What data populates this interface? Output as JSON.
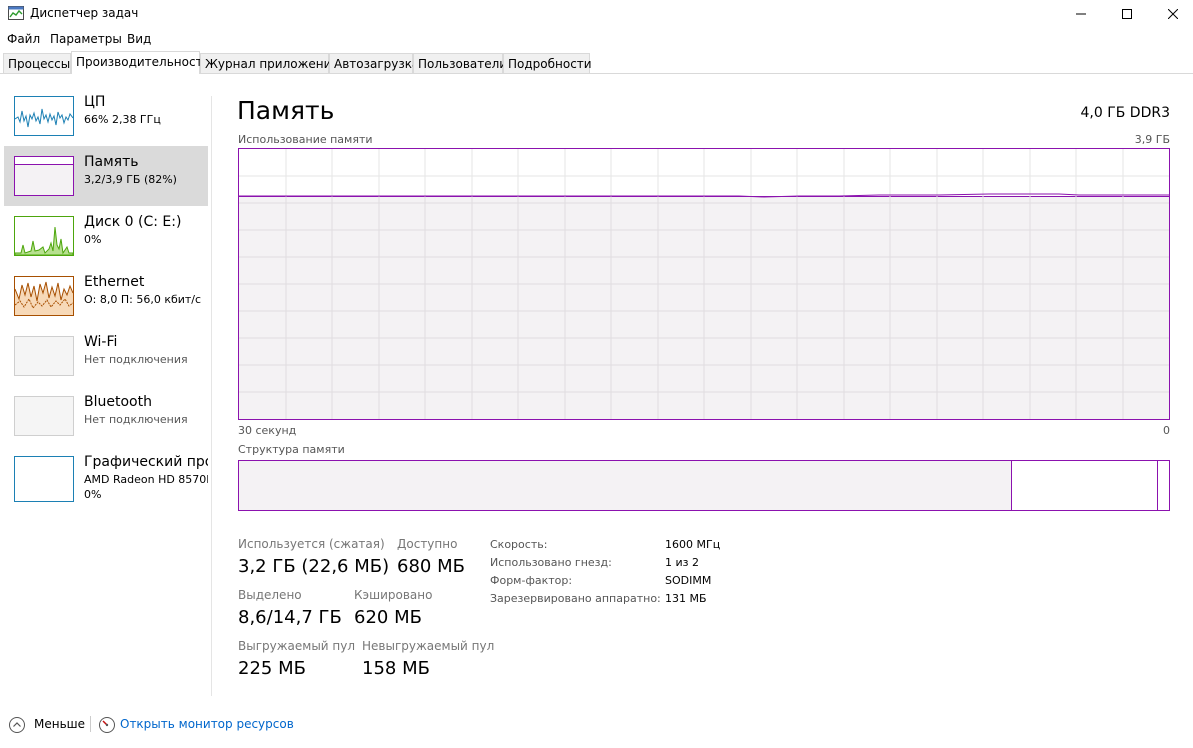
{
  "window": {
    "title": "Диспетчер задач"
  },
  "menu": [
    "Файл",
    "Параметры",
    "Вид"
  ],
  "tabs": [
    "Процессы",
    "Производительность",
    "Журнал приложений",
    "Автозагрузка",
    "Пользователи",
    "Подробности"
  ],
  "active_tab": "Производительность",
  "sidebar": {
    "items": [
      {
        "name": "ЦП",
        "sub": "66% 2,38 ГГц",
        "icon": "cpu-graph-icon",
        "color": "#1c80b4"
      },
      {
        "name": "Память",
        "sub": "3,2/3,9 ГБ (82%)",
        "icon": "memory-graph-icon",
        "color": "#8b12ae"
      },
      {
        "name": "Диск 0 (C: E:)",
        "sub": "0%",
        "icon": "disk-graph-icon",
        "color": "#4da60c"
      },
      {
        "name": "Ethernet",
        "sub": "О: 8,0 П: 56,0 кбит/с",
        "icon": "ethernet-graph-icon",
        "color": "#a74f01"
      },
      {
        "name": "Wi-Fi",
        "sub": "Нет подключения",
        "icon": "wifi-graph-icon",
        "color": "#cfcfcf"
      },
      {
        "name": "Bluetooth",
        "sub": "Нет подключения",
        "icon": "bluetooth-graph-icon",
        "color": "#cfcfcf"
      },
      {
        "name": "Графический про",
        "sub": "AMD Radeon HD 8570M",
        "sub2": "0%",
        "icon": "gpu-graph-icon",
        "color": "#1c80b4"
      }
    ]
  },
  "main": {
    "title": "Память",
    "spec": "4,0 ГБ DDR3",
    "usage_label": "Использование памяти",
    "usage_max": "3,9 ГБ",
    "time_left": "30 секунд",
    "time_right": "0",
    "structure_label": "Структура памяти",
    "accent": "#8b12ae",
    "usage_fraction": 0.82,
    "stats": {
      "in_use_label": "Используется (сжатая)",
      "in_use_value": "3,2 ГБ (22,6 МБ)",
      "available_label": "Доступно",
      "available_value": "680 МБ",
      "committed_label": "Выделено",
      "committed_value": "8,6/14,7 ГБ",
      "cached_label": "Кэшировано",
      "cached_value": "620 МБ",
      "paged_label": "Выгружаемый пул",
      "paged_value": "225 МБ",
      "nonpaged_label": "Невыгружаемый пул",
      "nonpaged_value": "158 МБ"
    },
    "props": [
      {
        "label": "Скорость:",
        "value": "1600 МГц"
      },
      {
        "label": "Использовано гнезд:",
        "value": "1 из 2"
      },
      {
        "label": "Форм-фактор:",
        "value": "SODIMM"
      },
      {
        "label": "Зарезервировано аппаратно:",
        "value": "131 МБ"
      }
    ]
  },
  "footer": {
    "less": "Меньше",
    "monitor": "Открыть монитор ресурсов",
    "link_color": "#0066cc"
  }
}
